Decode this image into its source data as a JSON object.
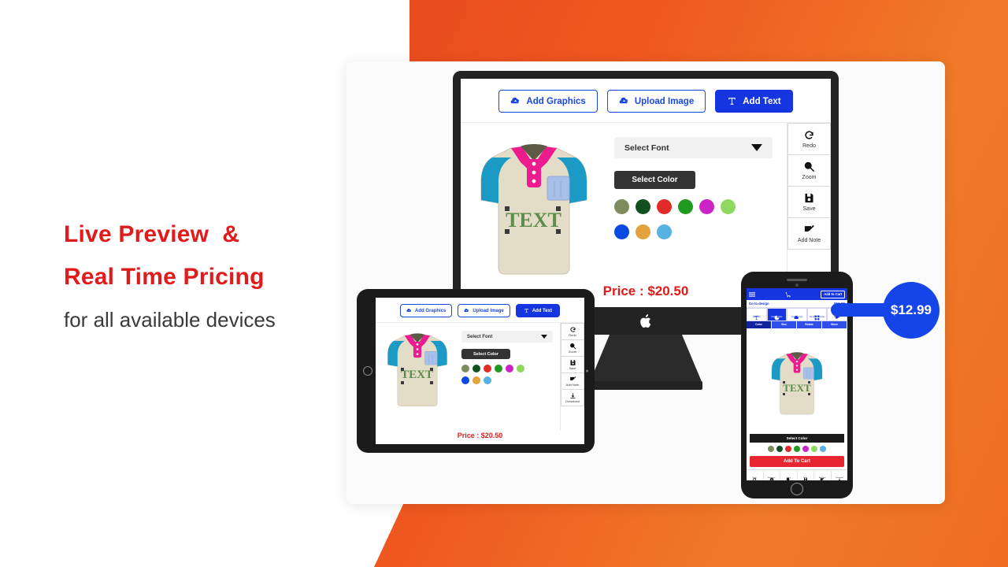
{
  "headline": {
    "line1": "Live Preview  &",
    "line2": "Real Time Pricing",
    "line3": "for all available devices",
    "accent_color": "#e01b1b"
  },
  "toolbar": {
    "add_graphics": "Add Graphics",
    "upload_image": "Upload Image",
    "add_text": "Add Text"
  },
  "controls": {
    "select_font": "Select Font",
    "select_color": "Select Color",
    "swatches_row1": [
      "#7d8c5c",
      "#14501f",
      "#e02b28",
      "#20991f",
      "#cc23c6",
      "#8ed860"
    ],
    "swatches_row2": [
      "#0b4ae0",
      "#e2a33c",
      "#57b2e2"
    ]
  },
  "tools": [
    {
      "label": "Redo",
      "icon": "redo-icon"
    },
    {
      "label": "Zoom",
      "icon": "zoom-icon"
    },
    {
      "label": "Save",
      "icon": "save-icon"
    },
    {
      "label": "Add Note",
      "icon": "add-note-icon"
    },
    {
      "label": "Download",
      "icon": "download-icon"
    }
  ],
  "shirt": {
    "text": "TEXT",
    "text_color": "#5e8c4a"
  },
  "desktop": {
    "price": "Price : $20.50"
  },
  "tablet": {
    "price": "Price : $20.50"
  },
  "phone": {
    "menu_icon": "hamburger-icon",
    "cart_icon": "cart-icon",
    "add_to_cart_top": "Add to Cart",
    "back_label": "Go to design",
    "price": "$12.99",
    "tabs": [
      {
        "label": "Add Text",
        "icon": "text-icon",
        "active": false
      },
      {
        "label": "Add Graphic",
        "icon": "graphic-icon",
        "active": true
      },
      {
        "label": "Upload Logo",
        "icon": "upload-icon",
        "active": false
      },
      {
        "label": "Name & Number",
        "icon": "grid-icon",
        "active": false
      },
      {
        "label": "Design",
        "icon": "design-icon",
        "active": false
      }
    ],
    "subtabs": [
      {
        "label": "Color",
        "active": true
      },
      {
        "label": "Size",
        "active": false
      },
      {
        "label": "Rotate",
        "active": false
      },
      {
        "label": "Move",
        "active": false
      }
    ],
    "select_color": "Select Color",
    "swatches": [
      "#7d8c5c",
      "#14501f",
      "#e02b28",
      "#20991f",
      "#cc23c6",
      "#8ed860",
      "#57b2e2"
    ],
    "add_to_cart": "Add To Cart",
    "bottom_tools": [
      {
        "label": "Redo",
        "icon": "redo-icon"
      },
      {
        "label": "Edit Layer",
        "icon": "layer-icon"
      },
      {
        "label": "Zoom",
        "icon": "zoom-icon"
      },
      {
        "label": "Save",
        "icon": "save-icon"
      },
      {
        "label": "Add Note",
        "icon": "add-note-icon"
      },
      {
        "label": "Download",
        "icon": "download-icon"
      }
    ]
  },
  "callout": {
    "price": "$12.99",
    "color": "#1545e8"
  }
}
